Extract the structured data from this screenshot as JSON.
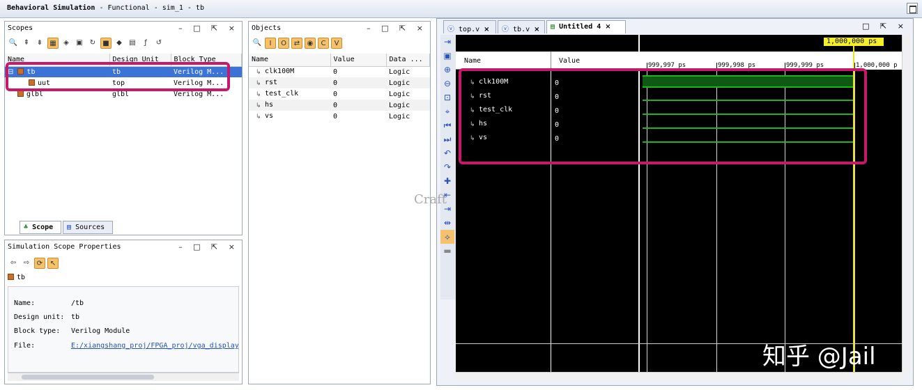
{
  "window": {
    "title_bold": "Behavioral Simulation",
    "title_rest": " - Functional - sim_1 - tb"
  },
  "scopes": {
    "title": "Scopes",
    "controls": "– □ ⇱ ×",
    "columns": [
      "Name",
      "Design Unit",
      "Block Type"
    ],
    "rows": [
      {
        "name": "tb",
        "unit": "tb",
        "type": "Verilog M..."
      },
      {
        "name": "uut",
        "unit": "top",
        "type": "Verilog M..."
      },
      {
        "name": "glbl",
        "unit": "glbl",
        "type": "Verilog M..."
      }
    ],
    "tab_scope": "Scope",
    "tab_sources": "Sources"
  },
  "scope_props": {
    "title": "Simulation Scope Properties",
    "controls": "– □ ⇱ ×",
    "item": "tb",
    "fields": [
      {
        "label": "Name:",
        "value": "/tb"
      },
      {
        "label": "Design unit:",
        "value": "tb"
      },
      {
        "label": "Block type:",
        "value": "Verilog Module"
      },
      {
        "label": "File:",
        "value": "E:/xiangshang_proj/FPGA_proj/vga_display/"
      }
    ]
  },
  "objects": {
    "title": "Objects",
    "controls": "– □ ⇱ ×",
    "columns": [
      "Name",
      "Value",
      "Data ..."
    ],
    "rows": [
      {
        "name": "clk100M",
        "value": "0",
        "type": "Logic"
      },
      {
        "name": "rst",
        "value": "0",
        "type": "Logic"
      },
      {
        "name": "test_clk",
        "value": "0",
        "type": "Logic"
      },
      {
        "name": "hs",
        "value": "0",
        "type": "Logic"
      },
      {
        "name": "vs",
        "value": "0",
        "type": "Logic"
      }
    ]
  },
  "wave": {
    "tabs": [
      "top.v",
      "tb.v",
      "Untitled 4"
    ],
    "columns": [
      "Name",
      "Value"
    ],
    "signals": [
      {
        "name": "clk100M",
        "value": "0"
      },
      {
        "name": "rst",
        "value": "0"
      },
      {
        "name": "test_clk",
        "value": "0"
      },
      {
        "name": "hs",
        "value": "0"
      },
      {
        "name": "vs",
        "value": "0"
      }
    ],
    "ticks": [
      "999,997 ps",
      "999,998 ps",
      "999,999 ps",
      "1,000,000 p"
    ],
    "cursor_label": "1,000,000 ps",
    "watermark": "Craft",
    "colors": {
      "signal": "#1fb31f",
      "cursor": "#e8e41a",
      "highlight": "#c8186a"
    }
  },
  "brand": {
    "text": "知乎 @Jail"
  }
}
